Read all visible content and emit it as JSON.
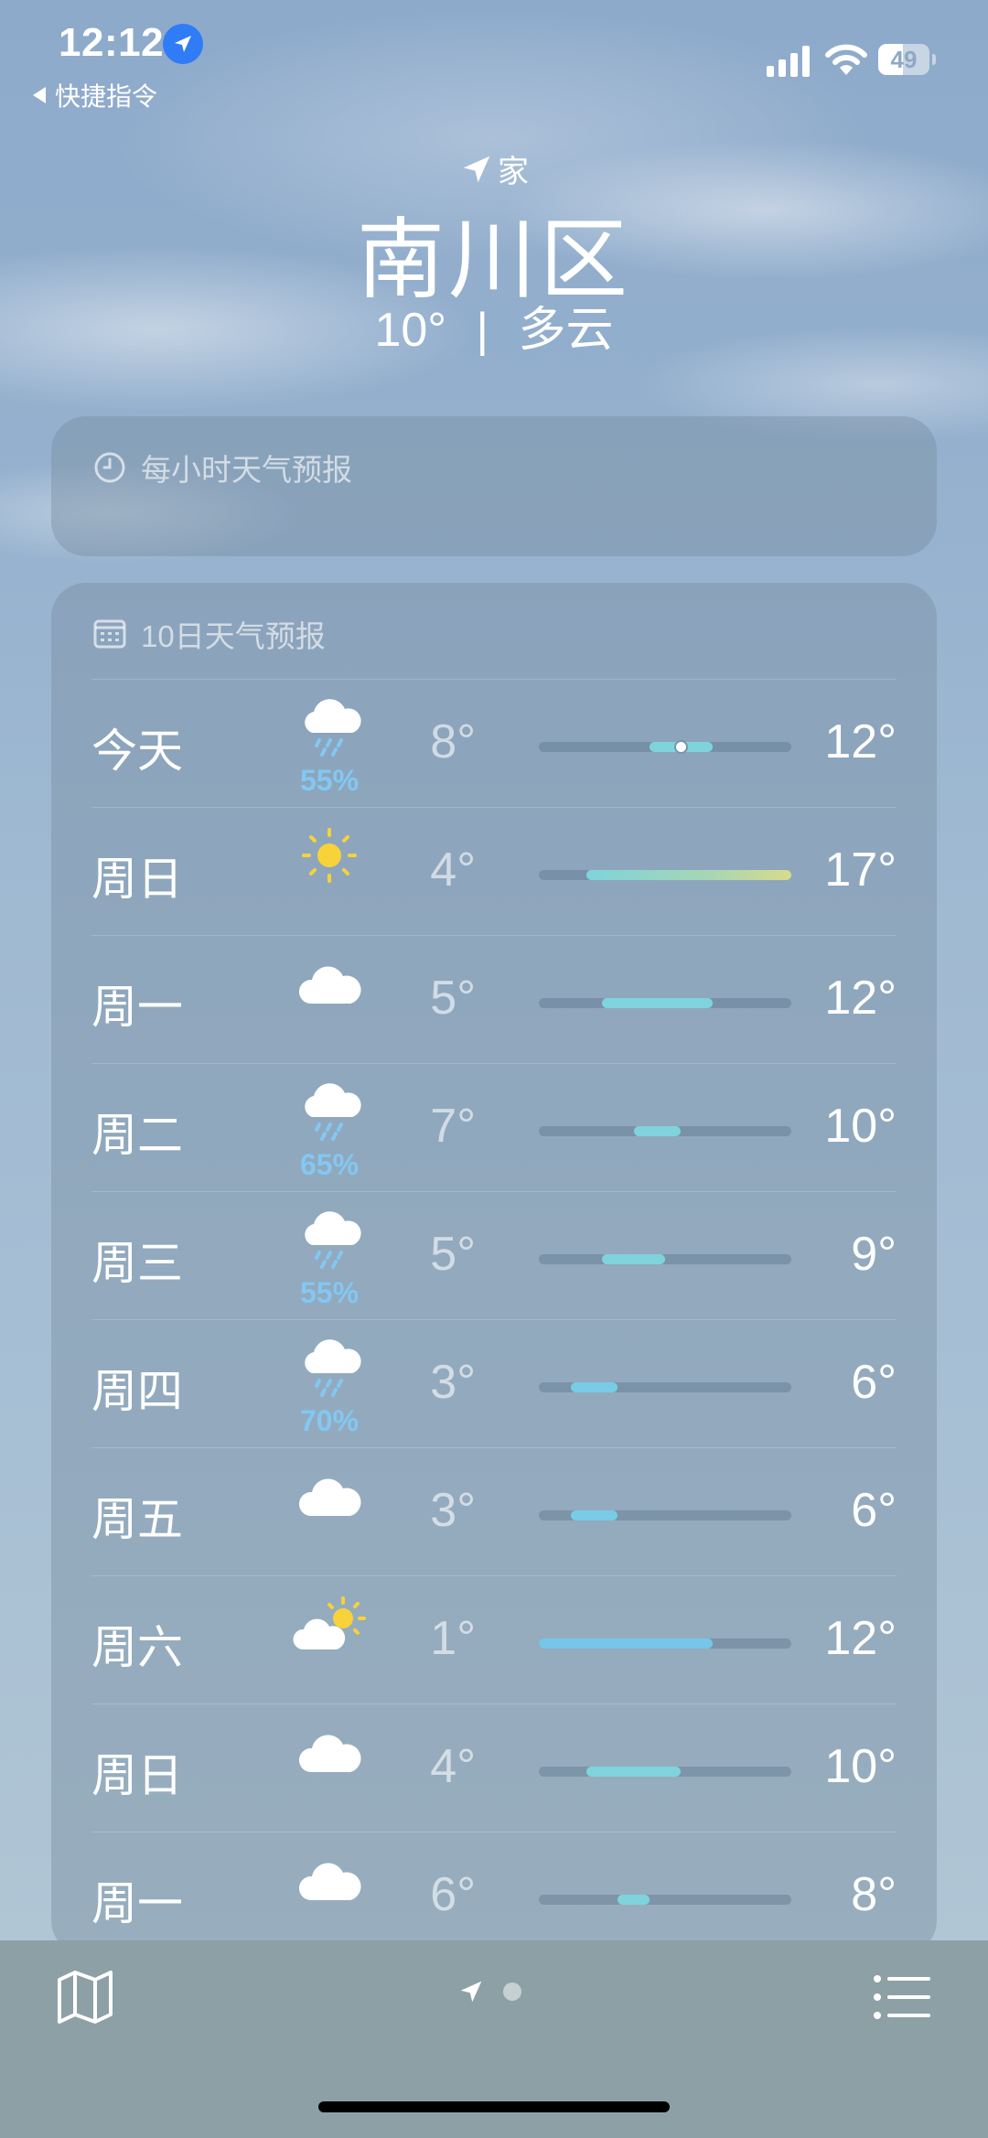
{
  "status": {
    "time": "12:12",
    "back_label": "快捷指令",
    "battery": "49"
  },
  "header": {
    "home_label": "家",
    "city": "南川区",
    "temp": "10°",
    "condition": "多云"
  },
  "hourly": {
    "title": "每小时天气预报"
  },
  "forecast": {
    "title": "10日天气预报",
    "scale": {
      "min": 1,
      "max": 17
    },
    "days": [
      {
        "day": "今天",
        "icon": "rain-cloud-icon",
        "precip": "55%",
        "low": "8°",
        "high": "12°",
        "low_val": 8,
        "high_val": 12,
        "current_val": 10,
        "bar_color": "#7fd3dc"
      },
      {
        "day": "周日",
        "icon": "sun-icon",
        "precip": "",
        "low": "4°",
        "high": "17°",
        "low_val": 4,
        "high_val": 17,
        "bar_color": "gradient"
      },
      {
        "day": "周一",
        "icon": "cloud-icon",
        "precip": "",
        "low": "5°",
        "high": "12°",
        "low_val": 5,
        "high_val": 12,
        "bar_color": "#7fd3dc"
      },
      {
        "day": "周二",
        "icon": "rain-cloud-icon",
        "precip": "65%",
        "low": "7°",
        "high": "10°",
        "low_val": 7,
        "high_val": 10,
        "bar_color": "#7fd3dc"
      },
      {
        "day": "周三",
        "icon": "rain-cloud-icon",
        "precip": "55%",
        "low": "5°",
        "high": "9°",
        "low_val": 5,
        "high_val": 9,
        "bar_color": "#7fd3dc"
      },
      {
        "day": "周四",
        "icon": "rain-cloud-icon",
        "precip": "70%",
        "low": "3°",
        "high": "6°",
        "low_val": 3,
        "high_val": 6,
        "bar_color": "#78cce6"
      },
      {
        "day": "周五",
        "icon": "cloud-icon",
        "precip": "",
        "low": "3°",
        "high": "6°",
        "low_val": 3,
        "high_val": 6,
        "bar_color": "#78cce6"
      },
      {
        "day": "周六",
        "icon": "partly-sunny-icon",
        "precip": "",
        "low": "1°",
        "high": "12°",
        "low_val": 1,
        "high_val": 12,
        "bar_color": "#76c6ea"
      },
      {
        "day": "周日",
        "icon": "cloud-icon",
        "precip": "",
        "low": "4°",
        "high": "10°",
        "low_val": 4,
        "high_val": 10,
        "bar_color": "#7fd3dc"
      },
      {
        "day": "周一",
        "icon": "cloud-icon",
        "precip": "",
        "low": "6°",
        "high": "8°",
        "low_val": 6,
        "high_val": 8,
        "bar_color": "#7fd3dc"
      }
    ]
  },
  "toolbar": {
    "map": "map-icon",
    "location": "location-arrow-icon",
    "list": "list-icon"
  }
}
